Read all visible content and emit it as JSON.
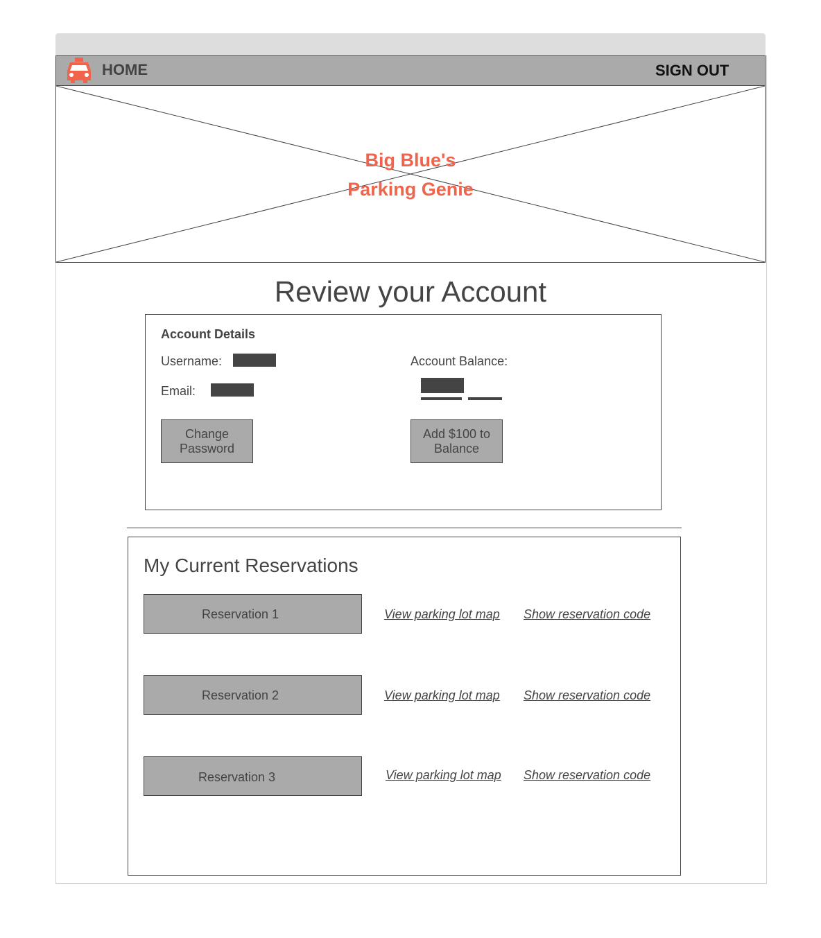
{
  "nav": {
    "home_label": "HOME",
    "signout_label": "SIGN OUT",
    "logo_icon": "taxi-icon",
    "logo_color": "#f0644c"
  },
  "hero": {
    "title_line1": "Big Blue's",
    "title_line2": "Parking Genie",
    "title_color": "#f0644c"
  },
  "page": {
    "title": "Review your Account"
  },
  "account": {
    "heading": "Account Details",
    "username_label": "Username:",
    "email_label": "Email:",
    "balance_label": "Account Balance:",
    "change_password_line1": "Change",
    "change_password_line2": "Password",
    "add_balance_line1": "Add $100 to",
    "add_balance_line2": "Balance"
  },
  "reservations": {
    "heading": "My Current Reservations",
    "items": [
      {
        "label": "Reservation 1",
        "map_link": "View parking lot map",
        "code_link": "Show reservation code"
      },
      {
        "label": "Reservation 2",
        "map_link": "View parking lot map",
        "code_link": "Show reservation code"
      },
      {
        "label": "Reservation 3",
        "map_link": "View parking lot map",
        "code_link": "Show reservation code"
      }
    ]
  }
}
